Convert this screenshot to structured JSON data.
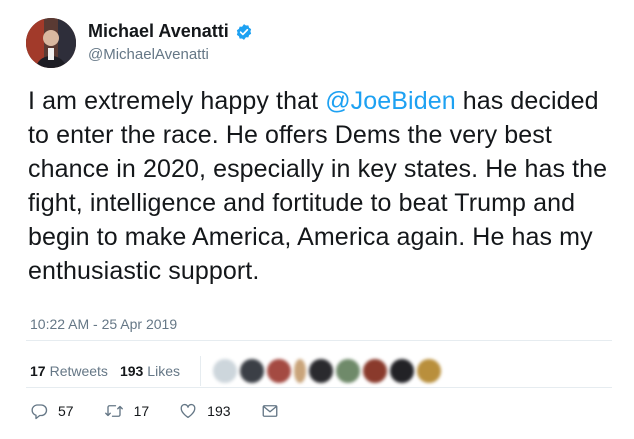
{
  "author": {
    "display_name": "Michael Avenatti",
    "handle": "@MichaelAvenatti",
    "verified": true
  },
  "tweet": {
    "text_before": "I am extremely happy that ",
    "mention": "@JoeBiden",
    "text_after": " has decided to enter the race. He offers Dems the very best chance in 2020, especially in key states. He has the fight, intelligence and fortitude to beat Trump and begin to make America, America again. He has my enthusiastic support.",
    "timestamp": "10:22 AM - 25 Apr 2019"
  },
  "stats": {
    "retweets_count": "17",
    "retweets_label": "Retweets",
    "likes_count": "193",
    "likes_label": "Likes"
  },
  "actions": {
    "reply_count": "57",
    "retweet_count": "17",
    "like_count": "193"
  },
  "colors": {
    "accent": "#1da1f2",
    "muted": "#657786",
    "divider": "#e6ecf0"
  },
  "icons": [
    "verified-badge-icon",
    "reply-icon",
    "retweet-icon",
    "like-icon",
    "message-icon"
  ]
}
